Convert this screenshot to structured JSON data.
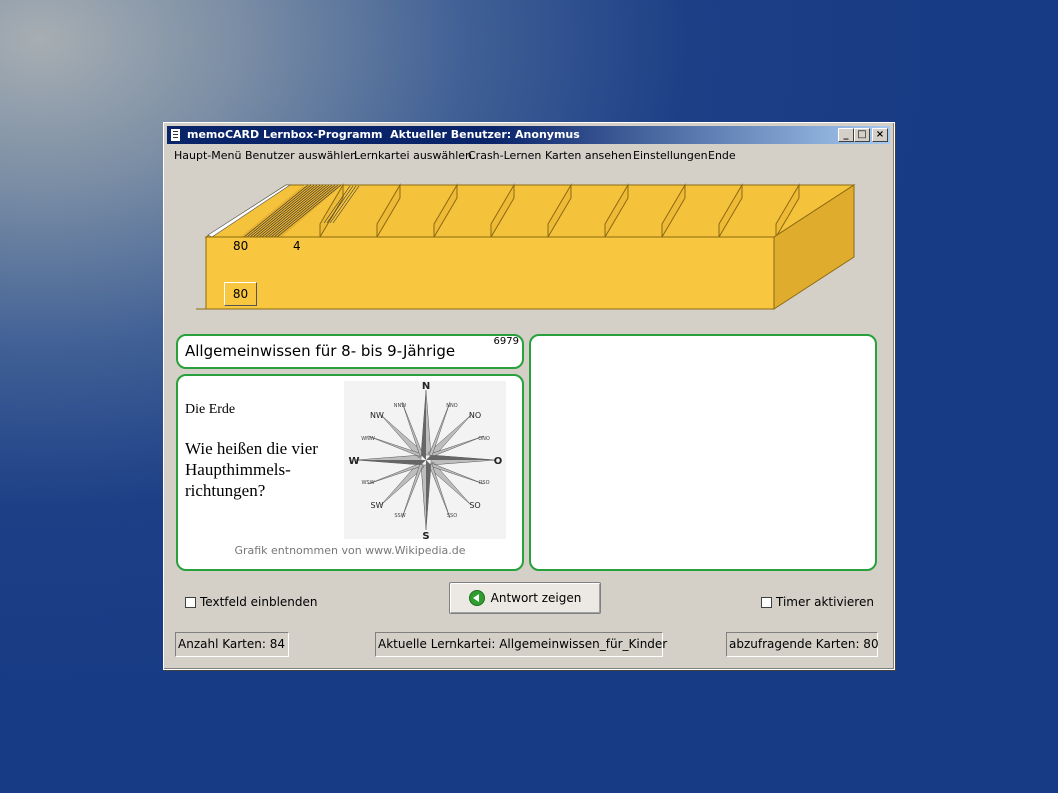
{
  "window": {
    "title": "memoCARD Lernbox-Programm  Aktueller Benutzer: Anonymus",
    "controls": {
      "minimize": "_",
      "maximize": "□",
      "close": "×"
    }
  },
  "menu": [
    "Haupt-Menü",
    "Benutzer auswählen",
    "Lernkartei auswählen",
    "Crash-Lernen",
    "Karten ansehen",
    "Einstellungen",
    "Ende"
  ],
  "lernbox": {
    "compartment1_count": "80",
    "compartment2_count": "4",
    "button_label": "80",
    "colors": {
      "front": "#f8c63f",
      "top": "#f5c23c",
      "side": "#e0ac2e",
      "edge": "#8a6a10"
    }
  },
  "card": {
    "topic": "Allgemeinwissen für 8- bis 9-Jährige",
    "id": "6979",
    "heading": "Die Erde",
    "question": "Wie heißen die vier Haupthimmels-richtungen?",
    "question_lines": [
      "Wie heißen die vier",
      "Haupthimmels-",
      "richtungen?"
    ],
    "image_credit": "Grafik entnommen von www.Wikipedia.de",
    "compass": {
      "N": "N",
      "S": "S",
      "W": "W",
      "O": "O",
      "NO": "NO",
      "NW": "NW",
      "SO": "SO",
      "SW": "SW",
      "NNW": "NNW",
      "NNO": "NNO",
      "WNW": "WNW",
      "ONO": "ONO",
      "WSW": "WSW",
      "OSO": "OSO",
      "SSW": "SSW",
      "SSO": "SSO"
    }
  },
  "controls": {
    "textfield_label": "Textfeld einblenden",
    "show_answer_label": "Antwort zeigen",
    "timer_label": "Timer aktivieren"
  },
  "status": {
    "card_count": "Anzahl Karten: 84",
    "current_box": "Aktuelle Lernkartei: Allgemeinwissen_für_Kinder",
    "cards_to_query": "abzufragende Karten: 80"
  },
  "accent_colors": {
    "panel_border": "#28a03c",
    "title_bar": "#0a246a"
  }
}
